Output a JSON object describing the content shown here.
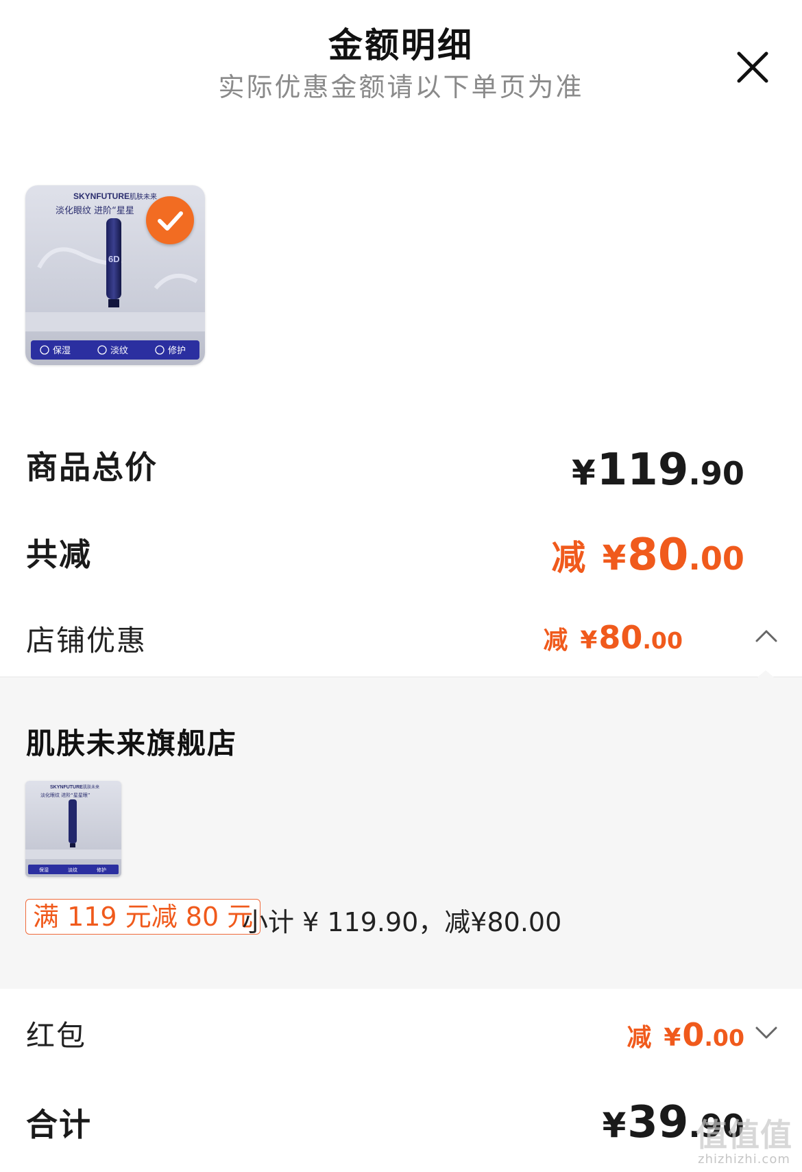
{
  "header": {
    "title": "金额明细",
    "subtitle": "实际优惠金额请以下单页为准",
    "close_icon": "close-icon"
  },
  "product": {
    "selected": true,
    "image": {
      "brand": "SKYNFUTURE",
      "brand_cn": "肌肤未来",
      "tagline": "淡化眼纹  进阶“星星",
      "tube_label": "6D",
      "badges": [
        "保湿",
        "淡纹",
        "修护"
      ]
    }
  },
  "summary": {
    "goods_total_label": "商品总价",
    "goods_total": {
      "yen": "¥",
      "int": "119",
      "dec": ".90"
    },
    "discount_label": "共减",
    "discount": {
      "prefix": "减",
      "yen": "¥",
      "int": "80",
      "dec": ".00"
    },
    "shop_discount_label": "店铺优惠",
    "shop_discount": {
      "prefix": "减",
      "yen": "¥",
      "int": "80",
      "dec": ".00"
    },
    "shop_discount_expanded": true
  },
  "shop_panel": {
    "store_name": "肌肤未来旗舰店",
    "small_image": {
      "brand": "SKYNFUTURE",
      "brand_cn": "肌肤未来",
      "tagline": "淡化眼纹  进阶“星星眼”",
      "badges": [
        "保湿",
        "淡纹",
        "修护"
      ]
    },
    "promo_tag": "满 119 元减 80 元",
    "subtotal_text": "小计 ¥ 119.90，减¥80.00"
  },
  "red_packet": {
    "label": "红包",
    "value": {
      "prefix": "减",
      "yen": "¥",
      "int": "0",
      "dec": ".00"
    },
    "expanded": false
  },
  "grand_total": {
    "label": "合计",
    "value": {
      "yen": "¥",
      "int": "39",
      "dec": ".90"
    }
  },
  "watermark": {
    "mark": "值值值",
    "site": "zhizhizhi.com"
  },
  "colors": {
    "accent": "#f05a1c",
    "check": "#f26c22",
    "panel_bg": "#f6f6f6",
    "subtitle": "#8a8a8a",
    "badge_bar": "#2b2fa0"
  }
}
